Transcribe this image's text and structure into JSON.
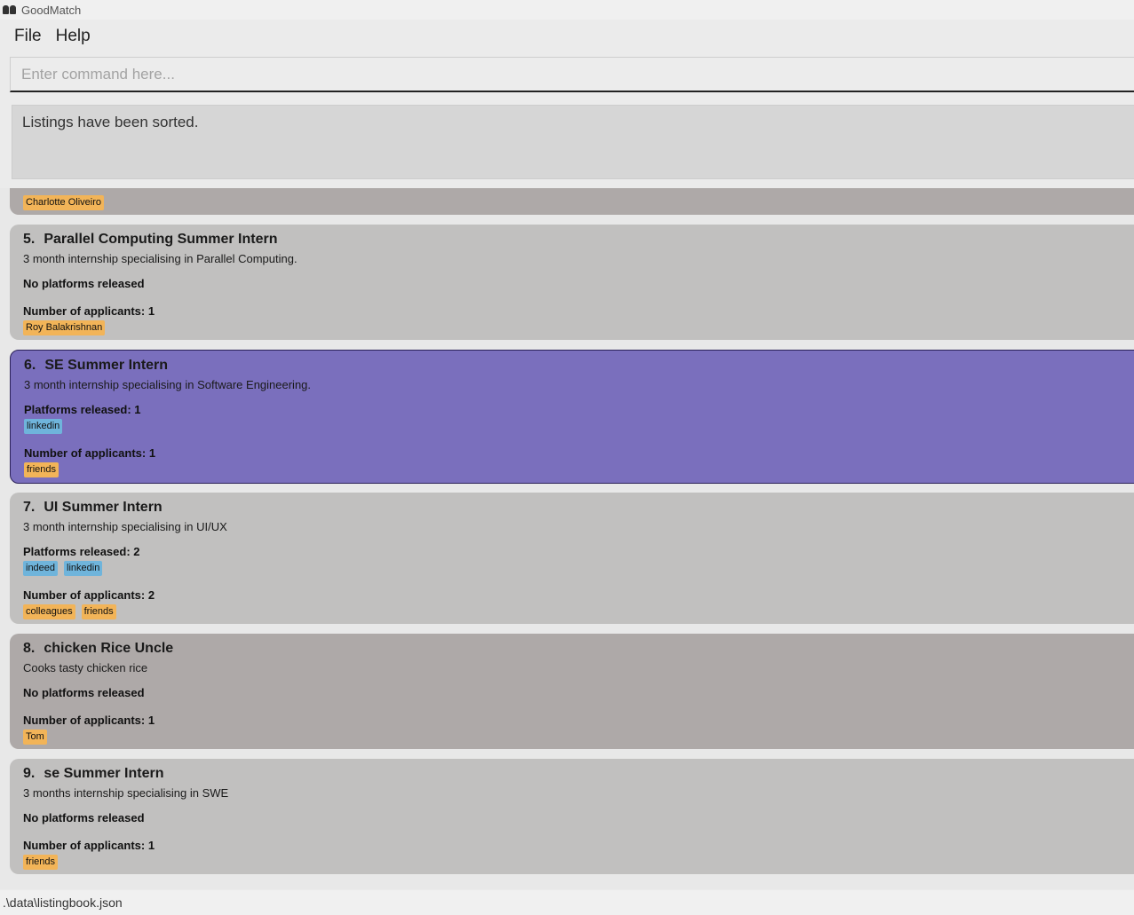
{
  "window": {
    "title": "GoodMatch",
    "icon": "app-binoculars-icon"
  },
  "menu": {
    "file": "File",
    "help": "Help"
  },
  "command": {
    "placeholder": "Enter command here...",
    "value": ""
  },
  "result": {
    "message": "Listings have been sorted."
  },
  "listings": {
    "partial": {
      "tags": [
        "Charlotte Oliveiro"
      ]
    },
    "items": [
      {
        "index": "5.",
        "title": "Parallel Computing Summer Intern",
        "description": "3 month internship specialising in Parallel Computing.",
        "platforms_label": "No platforms released",
        "platforms": [],
        "applicants_label": "Number of applicants: 1",
        "applicants": [
          "Roy Balakrishnan"
        ]
      },
      {
        "index": "6.",
        "title": "SE Summer Intern",
        "description": "3 month internship specialising in Software Engineering.",
        "platforms_label": "Platforms released: 1",
        "platforms": [
          "linkedin"
        ],
        "applicants_label": "Number of applicants: 1",
        "applicants": [
          "friends"
        ]
      },
      {
        "index": "7.",
        "title": "UI Summer Intern",
        "description": "3 month internship specialising in UI/UX",
        "platforms_label": "Platforms released: 2",
        "platforms": [
          "indeed",
          "linkedin"
        ],
        "applicants_label": "Number of applicants: 2",
        "applicants": [
          "colleagues",
          "friends"
        ]
      },
      {
        "index": "8.",
        "title": "chicken Rice Uncle",
        "description": "Cooks tasty chicken rice",
        "platforms_label": "No platforms released",
        "platforms": [],
        "applicants_label": "Number of applicants: 1",
        "applicants": [
          "Tom"
        ]
      },
      {
        "index": "9.",
        "title": "se Summer Intern",
        "description": "3 months internship specialising in SWE",
        "platforms_label": "No platforms released",
        "platforms": [],
        "applicants_label": "Number of applicants: 1",
        "applicants": [
          "friends"
        ]
      }
    ]
  },
  "status": {
    "file_path": ".\\data\\listingbook.json"
  },
  "colors": {
    "card_light": "#c1c0bf",
    "card_dark": "#aea9a8",
    "card_selected": "#7a6fbd",
    "tag_applicant": "#f2b458",
    "tag_platform": "#6fb4db"
  }
}
